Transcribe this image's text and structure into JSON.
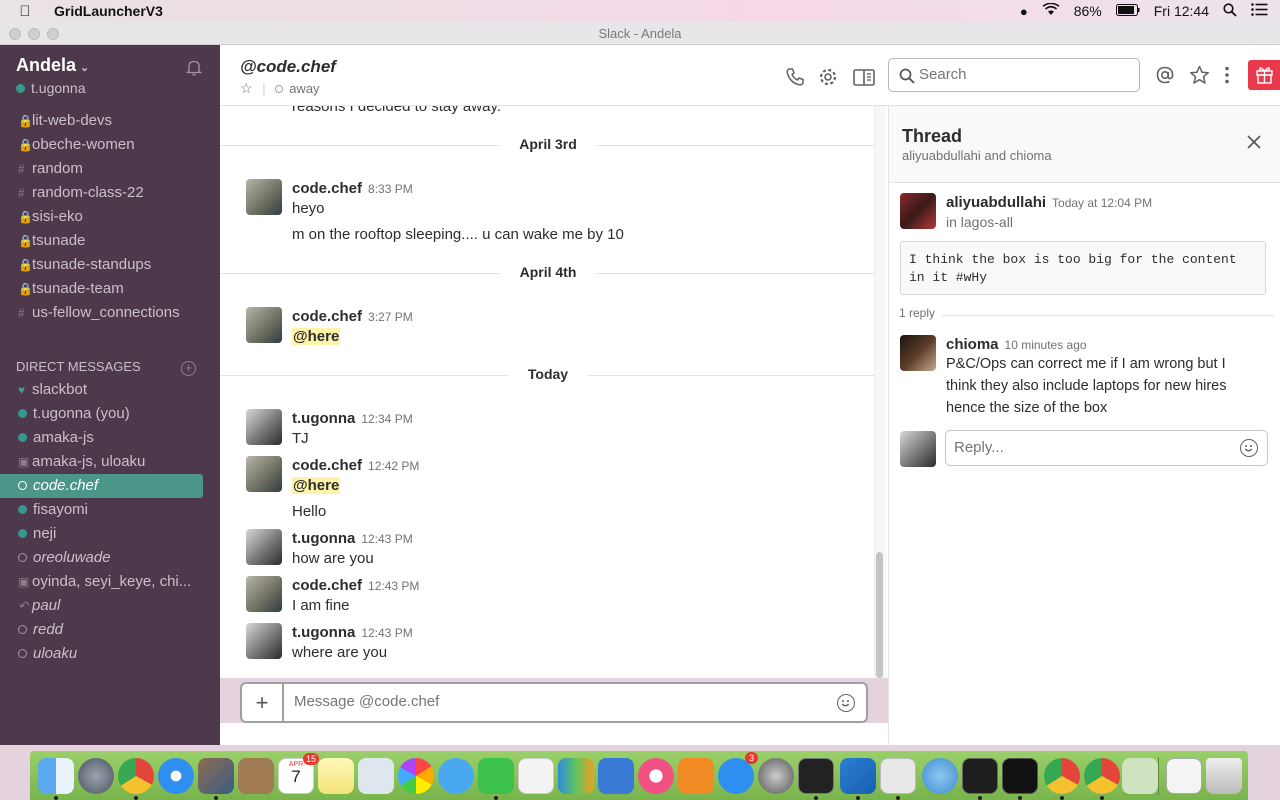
{
  "menubar": {
    "app_name": "GridLauncherV3",
    "battery": "86%",
    "clock": "Fri 12:44"
  },
  "window": {
    "title": "Slack - Andela"
  },
  "sidebar": {
    "team_name": "Andela",
    "current_user": "t.ugonna",
    "channels": [
      {
        "prefix": "lock",
        "name": "lit-web-devs"
      },
      {
        "prefix": "lock",
        "name": "obeche-women"
      },
      {
        "prefix": "hash",
        "name": "random"
      },
      {
        "prefix": "hash",
        "name": "random-class-22"
      },
      {
        "prefix": "lock",
        "name": "sisi-eko"
      },
      {
        "prefix": "lock",
        "name": "tsunade"
      },
      {
        "prefix": "lock",
        "name": "tsunade-standups"
      },
      {
        "prefix": "lock",
        "name": "tsunade-team"
      },
      {
        "prefix": "hash",
        "name": "us-fellow_connections"
      }
    ],
    "dm_header": "DIRECT MESSAGES",
    "dms": [
      {
        "status": "heart",
        "name": "slackbot"
      },
      {
        "status": "online",
        "name": "t.ugonna (you)"
      },
      {
        "status": "online",
        "name": "amaka-js"
      },
      {
        "status": "group",
        "name": "amaka-js, uloaku"
      },
      {
        "status": "away",
        "name": "code.chef",
        "active": true
      },
      {
        "status": "online",
        "name": "fisayomi"
      },
      {
        "status": "online",
        "name": "neji"
      },
      {
        "status": "away",
        "name": "oreoluwade"
      },
      {
        "status": "group",
        "name": "oyinda, seyi_keye, chi..."
      },
      {
        "status": "away",
        "name": "paul"
      },
      {
        "status": "away",
        "name": "redd"
      },
      {
        "status": "away",
        "name": "uloaku"
      }
    ]
  },
  "channel_header": {
    "name": "@code.chef",
    "presence": "away",
    "search_placeholder": "Search"
  },
  "messages": {
    "cut_text": "reasons I decided to stay away.",
    "day1": "April 3rd",
    "day2": "April 4th",
    "day3": "Today",
    "m1": {
      "user": "code.chef",
      "time": "8:33 PM",
      "line1": "heyo",
      "line2": "m on the rooftop sleeping.... u can wake me by 10"
    },
    "m2": {
      "user": "code.chef",
      "time": "3:27 PM",
      "mention": "@here"
    },
    "m3": {
      "user": "t.ugonna",
      "time": "12:34 PM",
      "text": "TJ"
    },
    "m4": {
      "user": "code.chef",
      "time": "12:42 PM",
      "mention": "@here",
      "line2": "Hello"
    },
    "m5": {
      "user": "t.ugonna",
      "time": "12:43 PM",
      "text": "how are you"
    },
    "m6": {
      "user": "code.chef",
      "time": "12:43 PM",
      "text": "I am fine"
    },
    "m7": {
      "user": "t.ugonna",
      "time": "12:43 PM",
      "text": "where are you"
    }
  },
  "composer": {
    "placeholder": "Message @code.chef"
  },
  "thread": {
    "title": "Thread",
    "participants": "aliyuabdullahi and chioma",
    "parent_user": "aliyuabdullahi",
    "parent_time": "Today at 12:04 PM",
    "parent_channel": "in lagos-all",
    "parent_code": "I think the box is too big for the content in it #wHy",
    "reply_count": "1 reply",
    "reply_user": "chioma",
    "reply_time": "10 minutes ago",
    "reply_text_1": "P&C/Ops can correct me if I am wrong but I",
    "reply_text_2": "think they also include laptops for new hires",
    "reply_text_3": "hence the size of the box",
    "reply_placeholder": "Reply..."
  },
  "dock": {
    "calendar_month": "APR",
    "calendar_day": "7",
    "calendar_badge": "15",
    "appstore_badge": "3"
  }
}
